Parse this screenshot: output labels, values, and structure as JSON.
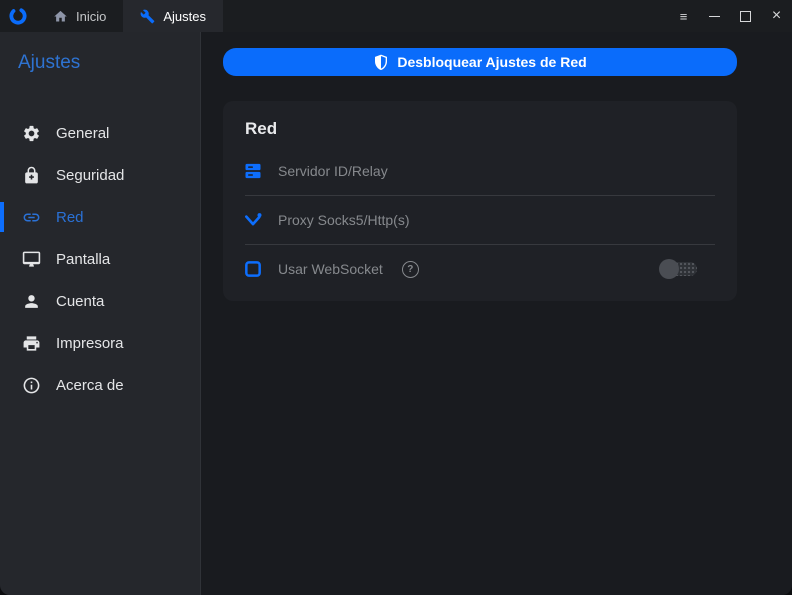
{
  "colors": {
    "accent_blue": "#0a6cfb",
    "sidebar_bg": "#25272c",
    "main_bg": "#191b1f",
    "card_bg": "#1f2126",
    "muted_text": "#86898d",
    "active_item_blue": "#2a71d6"
  },
  "window_controls": {
    "menu_glyph": "≡",
    "close_glyph": "×"
  },
  "tabbar": {
    "tabs": [
      {
        "label": "Inicio",
        "icon": "home-icon",
        "active": false
      },
      {
        "label": "Ajustes",
        "icon": "wrench-icon",
        "active": true
      }
    ]
  },
  "sidebar": {
    "title": "Ajustes",
    "items": [
      {
        "label": "General",
        "icon": "gear-icon",
        "active": false
      },
      {
        "label": "Seguridad",
        "icon": "lock-icon",
        "active": false
      },
      {
        "label": "Red",
        "icon": "link-icon",
        "active": true
      },
      {
        "label": "Pantalla",
        "icon": "monitor-icon",
        "active": false
      },
      {
        "label": "Cuenta",
        "icon": "person-icon",
        "active": false
      },
      {
        "label": "Impresora",
        "icon": "printer-icon",
        "active": false
      },
      {
        "label": "Acerca de",
        "icon": "info-icon",
        "active": false
      }
    ]
  },
  "main": {
    "unlock_button": {
      "label": "Desbloquear Ajustes de Red",
      "icon": "shield-icon"
    },
    "card": {
      "title": "Red",
      "rows": [
        {
          "label": "Servidor ID/Relay",
          "icon": "server-icon"
        },
        {
          "label": "Proxy Socks5/Http(s)",
          "icon": "proxy-icon"
        },
        {
          "label": "Usar WebSocket",
          "icon": "checkbox-icon",
          "help_glyph": "?",
          "toggle_state": "off"
        }
      ]
    }
  }
}
